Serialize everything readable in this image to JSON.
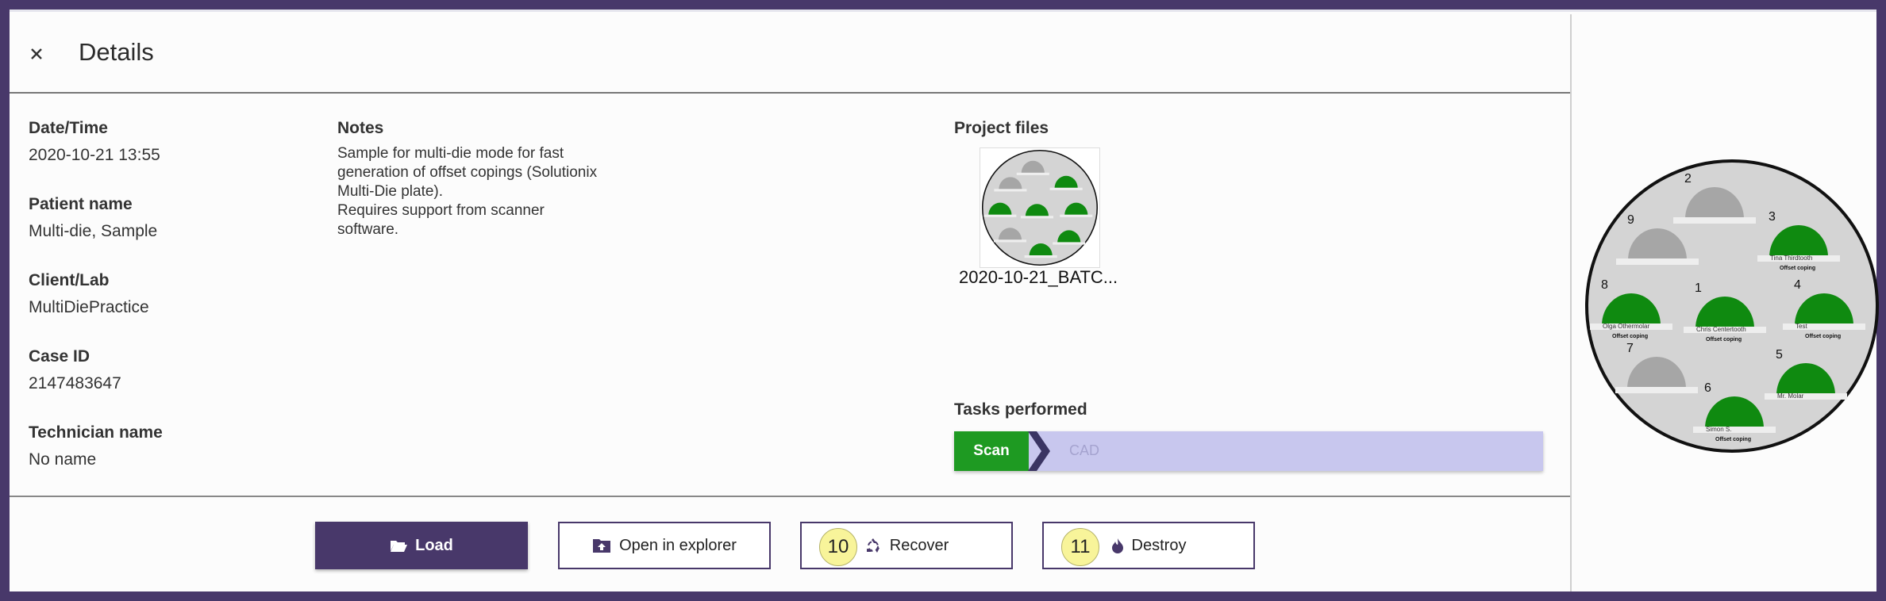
{
  "header": {
    "title": "Details",
    "close_icon": "close-icon"
  },
  "fields": [
    {
      "label": "Date/Time",
      "value": "2020-10-21 13:55"
    },
    {
      "label": "Patient name",
      "value": "Multi-die, Sample"
    },
    {
      "label": "Client/Lab",
      "value": "MultiDiePractice"
    },
    {
      "label": "Case ID",
      "value": "2147483647"
    },
    {
      "label": "Technician name",
      "value": "No name"
    }
  ],
  "notes": {
    "label": "Notes",
    "text": "Sample for multi-die mode for fast\ngeneration of offset copings (Solutionix\nMulti-Die plate).\nRequires support from scanner\nsoftware."
  },
  "project_files": {
    "label": "Project files",
    "file_name": "2020-10-21_BATC..."
  },
  "tasks": {
    "label": "Tasks performed",
    "items": [
      "Scan",
      "CAD"
    ]
  },
  "buttons": {
    "load": "Load",
    "open": "Open in explorer",
    "recover": "Recover",
    "destroy": "Destroy"
  },
  "badges": {
    "recover": "10",
    "destroy": "11"
  },
  "plate": {
    "dies": [
      {
        "num": "1",
        "status": "scanned",
        "patient": "Chris Centertooth",
        "type": "Offset coping"
      },
      {
        "num": "2",
        "status": "empty",
        "patient": "",
        "type": ""
      },
      {
        "num": "3",
        "status": "scanned",
        "patient": "Tina Thirdtooth",
        "type": "Offset coping"
      },
      {
        "num": "4",
        "status": "scanned",
        "patient": "Test",
        "type": "Offset coping"
      },
      {
        "num": "5",
        "status": "scanned",
        "patient": "Mr. Molar",
        "type": ""
      },
      {
        "num": "6",
        "status": "scanned",
        "patient": "Simon S.",
        "type": "Offset coping"
      },
      {
        "num": "7",
        "status": "empty",
        "patient": "",
        "type": ""
      },
      {
        "num": "8",
        "status": "scanned",
        "patient": "Olga Othermolar",
        "type": "Offset coping"
      },
      {
        "num": "9",
        "status": "empty",
        "patient": "",
        "type": ""
      }
    ]
  },
  "colors": {
    "accent": "#48386a",
    "scan_green": "#1e9a22",
    "tasks_bg": "#c8c7ee",
    "die_green": "#0f8a10",
    "die_grey": "#a6a6a6",
    "badge": "#f8f49a"
  }
}
